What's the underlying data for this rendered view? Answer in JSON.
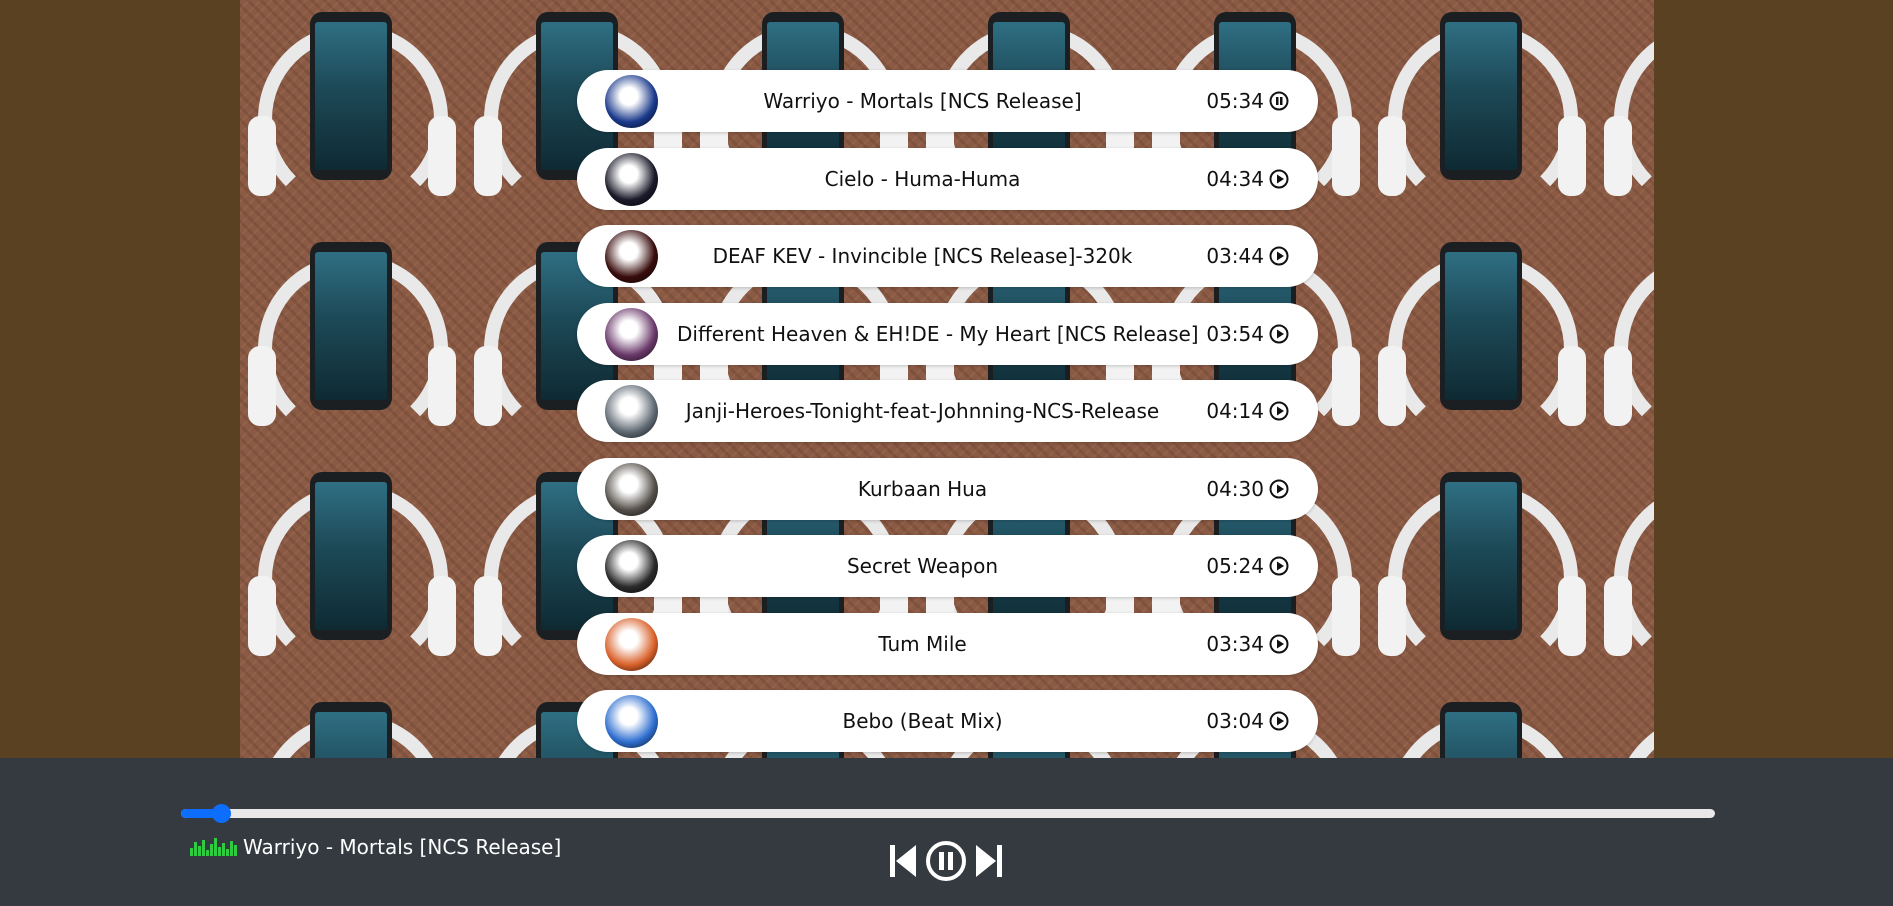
{
  "playlist": [
    {
      "title": "Warriyo - Mortals [NCS Release]",
      "duration": "05:34",
      "state": "pause-icon",
      "cover": "#1b3a8c"
    },
    {
      "title": "Cielo - Huma-Huma",
      "duration": "04:34",
      "state": "play-icon",
      "cover": "#1a1a2a"
    },
    {
      "title": "DEAF KEV - Invincible [NCS Release]-320k",
      "duration": "03:44",
      "state": "play-icon",
      "cover": "#3a0d0d"
    },
    {
      "title": "Different Heaven & EH!DE - My Heart [NCS Release]",
      "duration": "03:54",
      "state": "play-icon",
      "cover": "#6b3a6b"
    },
    {
      "title": "Janji-Heroes-Tonight-feat-Johnning-NCS-Release",
      "duration": "04:14",
      "state": "play-icon",
      "cover": "#606a74"
    },
    {
      "title": "Kurbaan Hua",
      "duration": "04:30",
      "state": "play-icon",
      "cover": "#55504a"
    },
    {
      "title": "Secret Weapon",
      "duration": "05:24",
      "state": "play-icon",
      "cover": "#2a2a2a"
    },
    {
      "title": "Tum Mile",
      "duration": "03:34",
      "state": "play-icon",
      "cover": "#d9612a"
    },
    {
      "title": "Bebo (Beat Mix)",
      "duration": "03:04",
      "state": "play-icon",
      "cover": "#2f6fd0"
    }
  ],
  "player": {
    "now_playing": "Warriyo - Mortals [NCS Release]",
    "progress": 0.026,
    "accent": "#0d6efd",
    "controls": [
      "previous-icon",
      "pause-icon",
      "next-icon"
    ]
  }
}
